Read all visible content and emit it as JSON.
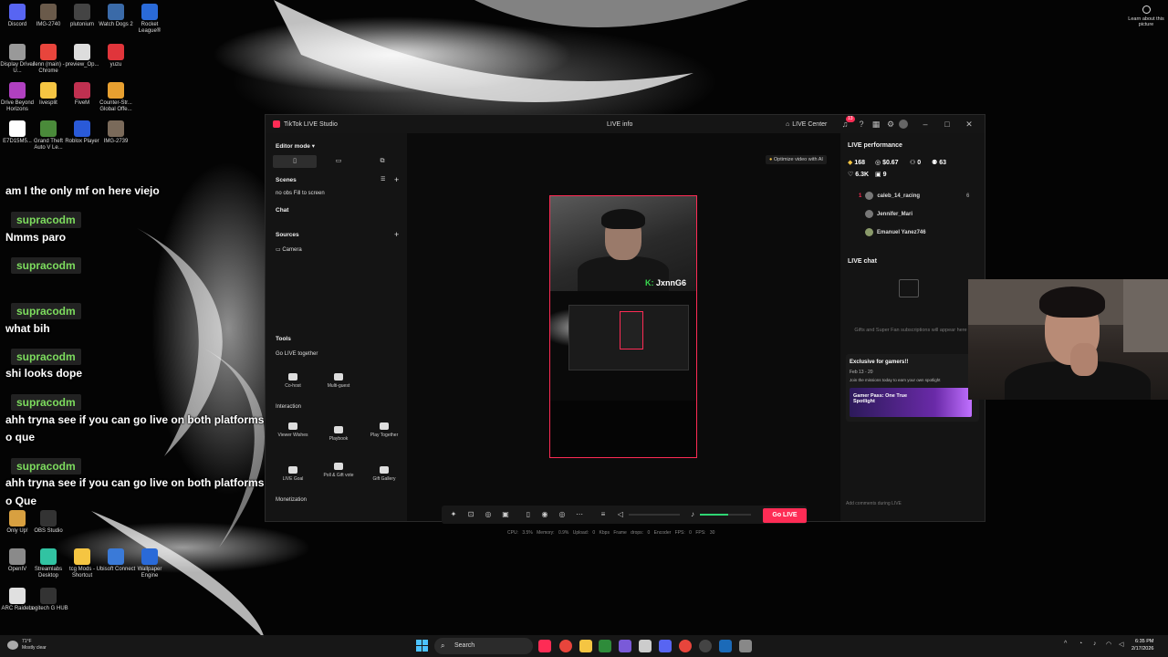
{
  "desktop_icons": [
    {
      "label": "Discord",
      "color": "#5865f2"
    },
    {
      "label": "IMG-2740",
      "color": "#6a5a4a"
    },
    {
      "label": "plutonium",
      "color": "#444"
    },
    {
      "label": "Watch Dogs 2",
      "color": "#3a6aa8"
    },
    {
      "label": "Rocket League®",
      "color": "#2a6ad8"
    },
    {
      "label": "Display Driver U...",
      "color": "#999"
    },
    {
      "label": "Jenn (main) - Chrome",
      "color": "#e8453c"
    },
    {
      "label": "preview_Op...",
      "color": "#ddd"
    },
    {
      "label": "yuzu",
      "color": "#e0353b"
    },
    {
      "label": "Drive Beyond Horizons",
      "color": "#b040c0"
    },
    {
      "label": "livesplit",
      "color": "#f5c542"
    },
    {
      "label": "FiveM",
      "color": "#c03050"
    },
    {
      "label": "Counter-Str... Global Offe...",
      "color": "#e8a030"
    },
    {
      "label": "E7D15M5...",
      "color": "#fff"
    },
    {
      "label": "Grand Theft Auto V Le...",
      "color": "#4a8a3a"
    },
    {
      "label": "Roblox Player",
      "color": "#2a5ad8"
    },
    {
      "label": "IMG-2739",
      "color": "#7a6a5a"
    },
    {
      "label": "Only Up!",
      "color": "#d8a040"
    },
    {
      "label": "OBS Studio",
      "color": "#333"
    },
    {
      "label": "OpenIV",
      "color": "#8a8a8a"
    },
    {
      "label": "Streamlabs Desktop",
      "color": "#31c3a2"
    },
    {
      "label": "tcg Mods - Shortcut",
      "color": "#f5c542"
    },
    {
      "label": "Ubisoft Connect",
      "color": "#3a7ad8"
    },
    {
      "label": "Wallpaper Engine",
      "color": "#2a6ad8"
    },
    {
      "label": "ARC Raiders",
      "color": "#e0e0e0"
    },
    {
      "label": "Logitech G HUB",
      "color": "#333"
    }
  ],
  "chat": {
    "messages": [
      {
        "kind": "text",
        "text": "am I the only mf on here viejo"
      },
      {
        "kind": "name",
        "text": "supracodm"
      },
      {
        "kind": "text",
        "text": "Nmms paro"
      },
      {
        "kind": "name",
        "text": "supracodm"
      },
      {
        "kind": "name",
        "text": "supracodm"
      },
      {
        "kind": "text",
        "text": "what bih"
      },
      {
        "kind": "name",
        "text": "supracodm"
      },
      {
        "kind": "text",
        "text": "shi looks dope"
      },
      {
        "kind": "name",
        "text": "supracodm"
      },
      {
        "kind": "text",
        "text": "ahh tryna see if you can go live on both platforms"
      },
      {
        "kind": "text",
        "text": "o que"
      },
      {
        "kind": "name",
        "text": "supracodm"
      },
      {
        "kind": "text",
        "text": "ahh tryna see if you can go live on both platforms"
      },
      {
        "kind": "text",
        "text": "o Que"
      }
    ]
  },
  "window": {
    "app_title": "TikTok LIVE Studio",
    "live_info": "LIVE info",
    "live_center": "LIVE Center",
    "notification_count": "13"
  },
  "left_panel": {
    "editor_mode": "Editor mode",
    "scenes": "Scenes",
    "scene_item": "no obs Fill to screen",
    "chat": "Chat",
    "sources": "Sources",
    "source_camera": "Camera",
    "tools": "Tools",
    "go_live_together": "Go LIVE together",
    "co_host": "Co-host",
    "multi_guest": "Multi-guest",
    "interaction": "Interaction",
    "viewer_wishes": "Viewer Wishes",
    "playbook": "Playbook",
    "play_together": "Play Together",
    "live_goal": "LIVE Goal",
    "poll_gift_vote": "Poll & Gift vote",
    "gift_gallery": "Gift Gallery",
    "monetization": "Monetization"
  },
  "center": {
    "optimize_label": "Optimize video with AI",
    "preview_tag_prefix": "K:",
    "preview_tag_name": "JxnnG6",
    "go_live": "Go LIVE",
    "mic_level": 0.55,
    "stats": {
      "cpu": "CPU: 3.5%",
      "memory": "Memory: 0.9%",
      "upload": "Upload: 0 Kbps",
      "frame_drops": "Frame drops: 0",
      "encoder_fps": "Encoder FPS: 0",
      "fps": "FPS: 30"
    }
  },
  "right_panel": {
    "live_performance": "LIVE performance",
    "diamonds": "168",
    "earnings": "$0.67",
    "new_followers": "0",
    "viewers": "63",
    "likes": "6.3K",
    "shares": "9",
    "top_viewers": [
      {
        "rank": "1",
        "name": "caleb_14_racing",
        "count": "6"
      },
      {
        "rank": "",
        "name": "Jennifer_Mari",
        "count": ""
      },
      {
        "rank": "",
        "name": "Emanuel Yanez746",
        "count": ""
      }
    ],
    "live_chat": "LIVE chat",
    "gift_note": "Gifts and Super Fan subscriptions will appear here",
    "promo_title": "Exclusive for gamers!!",
    "promo_dates": "Feb 13 - 20",
    "promo_desc": "Join the missions today to earn your own spotlight",
    "promo_banner": "Gamer Pass: One True Spotlight",
    "comment_placeholder": "Add comments during LIVE"
  },
  "taskbar": {
    "search": "Search",
    "weather_temp": "71°F",
    "weather_desc": "Mostly clear",
    "time": "6:35 PM",
    "date": "2/17/2026"
  },
  "desktop_corner": {
    "learn_about": "Learn about this picture"
  }
}
